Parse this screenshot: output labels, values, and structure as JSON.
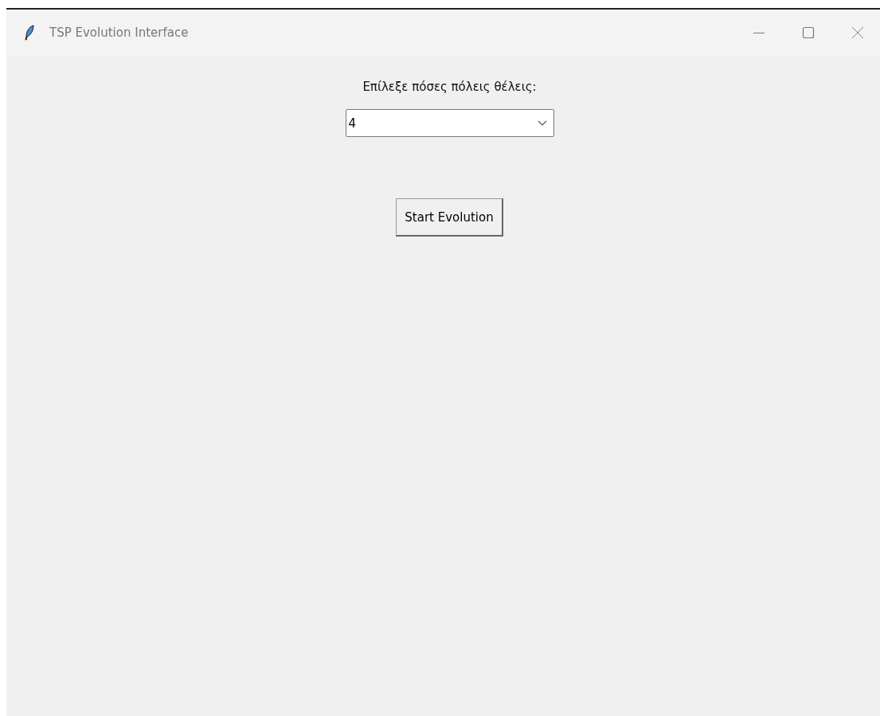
{
  "window": {
    "title": "TSP Evolution Interface"
  },
  "prompt": "Επίλεξε πόσες πόλεις θέλεις:",
  "city_count": {
    "value": "4"
  },
  "start_button": "Start Evolution"
}
